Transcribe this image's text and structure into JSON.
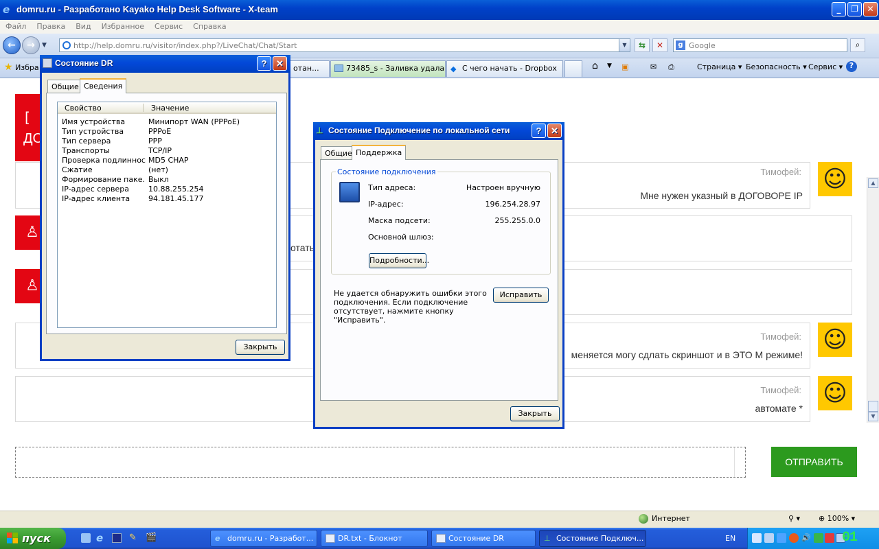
{
  "ie": {
    "title": "domru.ru - Разработано Kayako Help Desk Software - X-team",
    "menu": [
      "Файл",
      "Правка",
      "Вид",
      "Избранное",
      "Сервис",
      "Справка"
    ],
    "address_url": "http://help.domru.ru/visitor/index.php?/LiveChat/Chat/Start",
    "search_placeholder": "Google",
    "favorites_label": "Избра",
    "tabs": [
      {
        "label": "отан..."
      },
      {
        "label": "73485_s - Заливка удала..."
      },
      {
        "label": "С чего начать - Dropbox"
      }
    ],
    "commands": {
      "page": "Страница",
      "security": "Безопасность",
      "service": "Сервис"
    },
    "status_zone": "Интернет",
    "zoom": "100%"
  },
  "chat": {
    "messages": [
      {
        "author": "Тимофей:",
        "text": "Мне нужен указный в ДОГОВОРЕ IP"
      },
      {
        "author": "",
        "text": "отать"
      },
      {
        "author": "",
        "text": ""
      },
      {
        "author": "Тимофей:",
        "text": "меняется могу сдлать скриншот и в ЭТО М режиме!"
      },
      {
        "author": "Тимофей:",
        "text": "автомате *"
      }
    ],
    "red_label_top": "ДО",
    "send_label": "ОТПРАВИТЬ",
    "smile": "☺"
  },
  "dlg_dr": {
    "title": "Состояние DR",
    "tabs": [
      "Общие",
      "Сведения"
    ],
    "col_property": "Свойство",
    "col_value": "Значение",
    "rows": [
      {
        "k": "Имя устройства",
        "v": "Минипорт WAN (PPPoE)"
      },
      {
        "k": "Тип устройства",
        "v": "PPPoE"
      },
      {
        "k": "Тип сервера",
        "v": "PPP"
      },
      {
        "k": "Транспорты",
        "v": "TCP/IP"
      },
      {
        "k": "Проверка подлинности",
        "v": "MD5 CHAP"
      },
      {
        "k": "Сжатие",
        "v": "(нет)"
      },
      {
        "k": "Формирование паке...",
        "v": "Выкл"
      },
      {
        "k": "IP-адрес сервера",
        "v": "10.88.255.254"
      },
      {
        "k": "IP-адрес клиента",
        "v": "94.181.45.177"
      }
    ],
    "close_label": "Закрыть"
  },
  "dlg_lan": {
    "title": "Состояние Подключение по локальной сети",
    "tabs": [
      "Общие",
      "Поддержка"
    ],
    "group_label": "Состояние подключения",
    "fields": [
      {
        "k": "Тип адреса:",
        "v": "Настроен вручную"
      },
      {
        "k": "IP-адрес:",
        "v": "196.254.28.97"
      },
      {
        "k": "Маска подсети:",
        "v": "255.255.0.0"
      },
      {
        "k": "Основной шлюз:",
        "v": ""
      }
    ],
    "details_label": "Подробности...",
    "repair_text": "Не удается обнаружить ошибки этого подключения. Если подключение отсутствует, нажмите кнопку \"Исправить\".",
    "repair_label": "Исправить",
    "close_label": "Закрыть"
  },
  "taskbar": {
    "start": "пуск",
    "tasks": [
      {
        "label": "domru.ru - Разработ..."
      },
      {
        "label": "DR.txt - Блокнот"
      },
      {
        "label": "Состояние DR"
      },
      {
        "label": "Состояние Подключ..."
      }
    ],
    "lang": "EN",
    "clock": "01"
  },
  "colors": {
    "brand_red": "#e30613",
    "send_green": "#2c9a1e",
    "smile_yellow": "#ffc800",
    "xp_blue": "#0a3fc4"
  }
}
